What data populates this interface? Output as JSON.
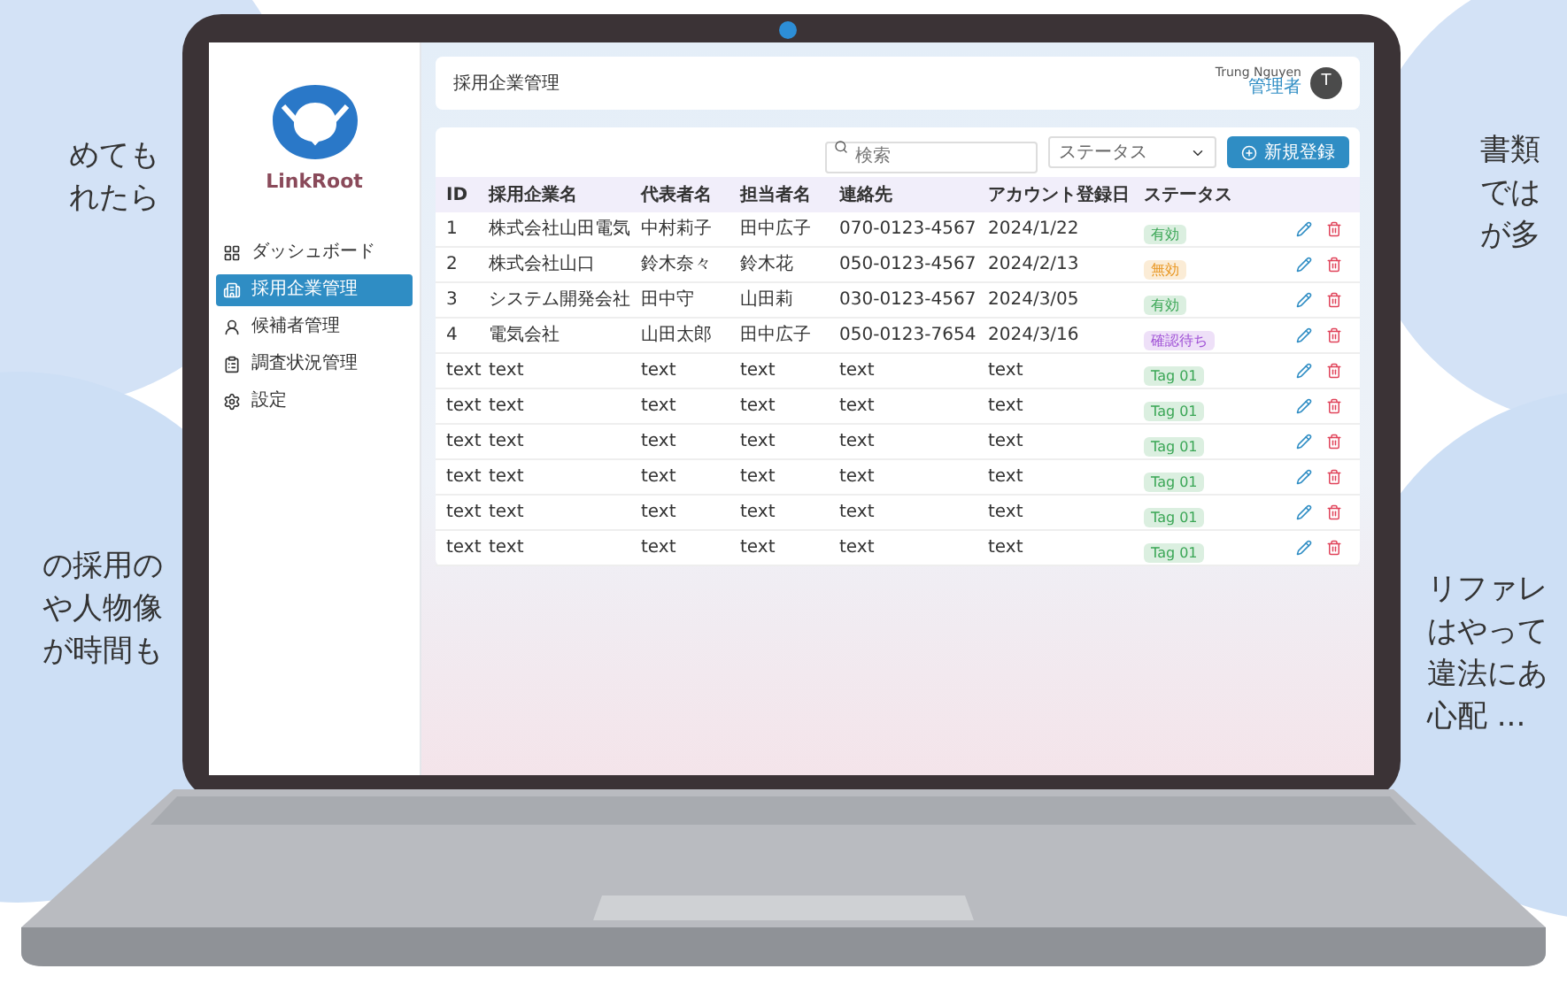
{
  "bubbles": [
    {
      "lines": [
        "めても",
        "れたら"
      ]
    },
    {
      "lines": [
        "の採用の",
        "や人物像",
        "が時間も"
      ]
    },
    {
      "lines": [
        "書類",
        "では",
        "が多"
      ]
    },
    {
      "lines": [
        "リファレ",
        "はやって",
        "違法にあ",
        "心配 ..."
      ]
    }
  ],
  "sidebar": {
    "logo": "LinkRoot",
    "items": [
      {
        "label": "ダッシュボード",
        "selected": false
      },
      {
        "label": "採用企業管理",
        "selected": true
      },
      {
        "label": "候補者管理",
        "selected": false
      },
      {
        "label": "調査状況管理",
        "selected": false
      },
      {
        "label": "設定",
        "selected": false
      }
    ]
  },
  "header": {
    "title": "採用企業管理",
    "user_name": "Trung Nguyen",
    "user_role": "管理者",
    "avatar": "T"
  },
  "toolbar": {
    "search_placeholder": "検索",
    "status_placeholder": "ステータス",
    "add_button": "新規登録"
  },
  "table": {
    "columns": [
      "ID",
      "採用企業名",
      "代表者名",
      "担当者名",
      "連絡先",
      "アカウント登録日",
      "ステータス"
    ],
    "rows": [
      {
        "cells": [
          "1",
          "株式会社山田電気",
          "中村莉子",
          "田中広子",
          "070-0123-4567",
          "2024/1/22"
        ],
        "status": "有効",
        "color": "#3aa655"
      },
      {
        "cells": [
          "2",
          "株式会社山口",
          "鈴木奈々",
          "鈴木花",
          "050-0123-4567",
          "2024/2/13"
        ],
        "status": "無効",
        "color": "#e8951e"
      },
      {
        "cells": [
          "3",
          "システム開発会社",
          "田中守",
          "山田莉",
          "030-0123-4567",
          "2024/3/05"
        ],
        "status": "有効",
        "color": "#3aa655"
      },
      {
        "cells": [
          "4",
          "電気会社",
          "山田太郎",
          "田中広子",
          "050-0123-7654",
          "2024/3/16"
        ],
        "status": "確認待ち",
        "color": "#a052d6"
      },
      {
        "cells": [
          "text",
          "text",
          "text",
          "text",
          "text",
          "text"
        ],
        "status": "Tag 01",
        "color": "#3aa655"
      },
      {
        "cells": [
          "text",
          "text",
          "text",
          "text",
          "text",
          "text"
        ],
        "status": "Tag 01",
        "color": "#3aa655"
      },
      {
        "cells": [
          "text",
          "text",
          "text",
          "text",
          "text",
          "text"
        ],
        "status": "Tag 01",
        "color": "#3aa655"
      },
      {
        "cells": [
          "text",
          "text",
          "text",
          "text",
          "text",
          "text"
        ],
        "status": "Tag 01",
        "color": "#3aa655"
      },
      {
        "cells": [
          "text",
          "text",
          "text",
          "text",
          "text",
          "text"
        ],
        "status": "Tag 01",
        "color": "#3aa655"
      },
      {
        "cells": [
          "text",
          "text",
          "text",
          "text",
          "text",
          "text"
        ],
        "status": "Tag 01",
        "color": "#3aa655"
      }
    ]
  }
}
